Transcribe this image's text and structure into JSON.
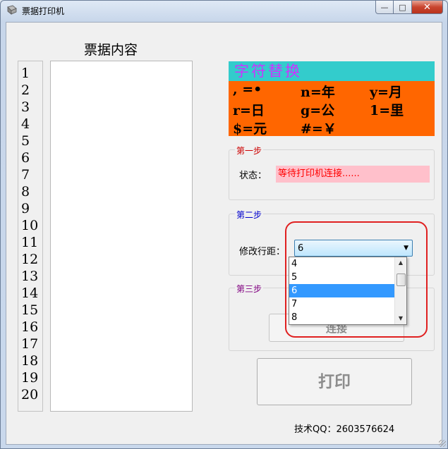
{
  "window": {
    "title": "票据打印机",
    "min_glyph": "—",
    "max_glyph": "□",
    "close_glyph": "✕"
  },
  "content": {
    "heading": "票据内容",
    "line_numbers": [
      "1",
      "2",
      "3",
      "4",
      "5",
      "6",
      "7",
      "8",
      "9",
      "10",
      "11",
      "12",
      "13",
      "14",
      "15",
      "16",
      "17",
      "18",
      "19",
      "20"
    ]
  },
  "legend": {
    "heading": "字符替换",
    "rows": [
      [
        ", =•",
        "n=年",
        "y=月"
      ],
      [
        "r=日",
        "g=公",
        "1=里"
      ],
      [
        "$=元",
        "#=￥",
        ""
      ]
    ],
    "colors": {
      "head_bg": "#33cccc",
      "head_text": "#cc33ff",
      "body_bg": "#ff6600"
    }
  },
  "step1": {
    "label": "第一步",
    "label_color": "#cc0000",
    "status_label": "状态：",
    "status_value": "等待打印机连接......"
  },
  "step2": {
    "label": "第二步",
    "label_color": "#0000cc",
    "spacing_label": "修改行距：",
    "selected": "6",
    "options": [
      "4",
      "5",
      "6",
      "7",
      "8"
    ]
  },
  "step3": {
    "label": "第三步",
    "label_color": "#800080",
    "connect_label": "连接"
  },
  "print_label": "打印",
  "footer": "技术QQ：2603576624"
}
